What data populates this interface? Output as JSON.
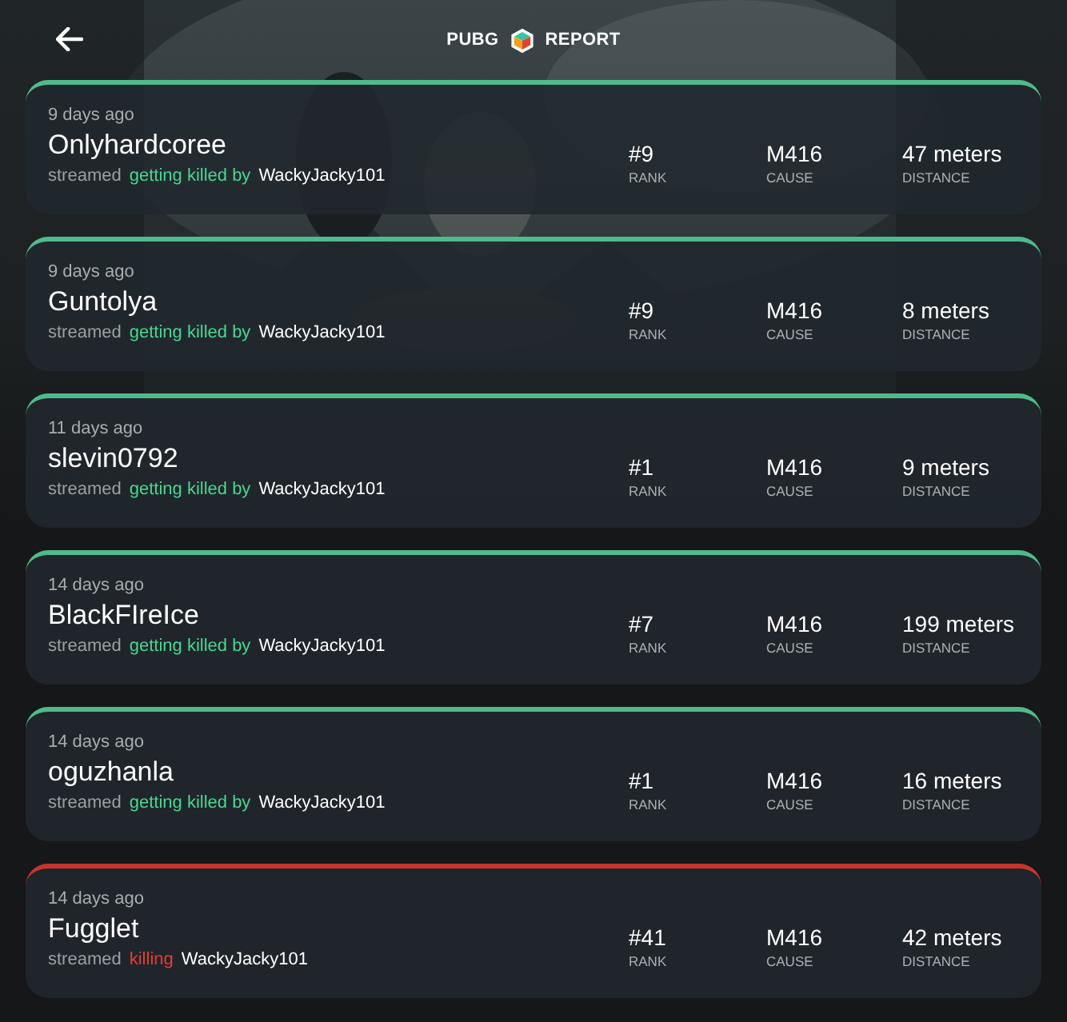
{
  "header": {
    "title_left": "PUBG",
    "title_right": "REPORT"
  },
  "events": [
    {
      "kind": "death",
      "time": "9 days ago",
      "player": "Onlyhardcoree",
      "prefix": "streamed",
      "verb": "getting killed by",
      "opponent": "WackyJacky101",
      "rank": "#9",
      "rank_label": "RANK",
      "cause": "M416",
      "cause_label": "CAUSE",
      "distance": "47 meters",
      "distance_label": "DISTANCE"
    },
    {
      "kind": "death",
      "time": "9 days ago",
      "player": "Guntolya",
      "prefix": "streamed",
      "verb": "getting killed by",
      "opponent": "WackyJacky101",
      "rank": "#9",
      "rank_label": "RANK",
      "cause": "M416",
      "cause_label": "CAUSE",
      "distance": "8 meters",
      "distance_label": "DISTANCE"
    },
    {
      "kind": "death",
      "time": "11 days ago",
      "player": "slevin0792",
      "prefix": "streamed",
      "verb": "getting killed by",
      "opponent": "WackyJacky101",
      "rank": "#1",
      "rank_label": "RANK",
      "cause": "M416",
      "cause_label": "CAUSE",
      "distance": "9 meters",
      "distance_label": "DISTANCE"
    },
    {
      "kind": "death",
      "time": "14 days ago",
      "player": "BlackFIreIce",
      "prefix": "streamed",
      "verb": "getting killed by",
      "opponent": "WackyJacky101",
      "rank": "#7",
      "rank_label": "RANK",
      "cause": "M416",
      "cause_label": "CAUSE",
      "distance": "199 meters",
      "distance_label": "DISTANCE"
    },
    {
      "kind": "death",
      "time": "14 days ago",
      "player": "oguzhanla",
      "prefix": "streamed",
      "verb": "getting killed by",
      "opponent": "WackyJacky101",
      "rank": "#1",
      "rank_label": "RANK",
      "cause": "M416",
      "cause_label": "CAUSE",
      "distance": "16 meters",
      "distance_label": "DISTANCE"
    },
    {
      "kind": "kill",
      "time": "14 days ago",
      "player": "Fugglet",
      "prefix": "streamed",
      "verb": "killing",
      "opponent": "WackyJacky101",
      "rank": "#41",
      "rank_label": "RANK",
      "cause": "M416",
      "cause_label": "CAUSE",
      "distance": "42 meters",
      "distance_label": "DISTANCE"
    }
  ]
}
